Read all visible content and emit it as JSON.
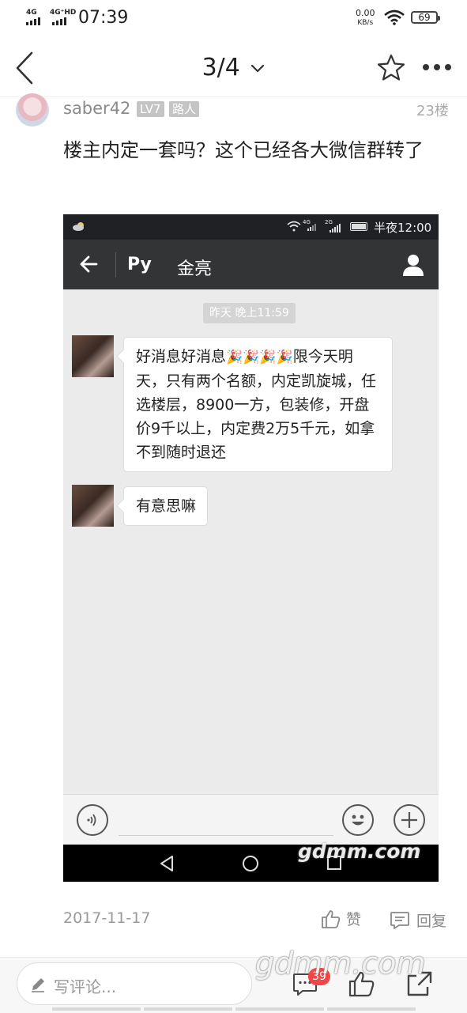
{
  "status_bar": {
    "sim1": "4G",
    "sim2": "4G⁺HD",
    "time": "07:39",
    "speed_value": "0.00",
    "speed_unit": "KB/s",
    "battery": "69"
  },
  "nav": {
    "page_indicator": "3/4"
  },
  "post": {
    "username": "saber42",
    "level": "LV7",
    "rank": "路人",
    "floor": "23楼",
    "text": "楼主内定一套吗？这个已经各大微信群转了",
    "date": "2017-11-17",
    "like_label": "赞",
    "reply_label": "回复"
  },
  "screenshot": {
    "status": {
      "network1": "4G",
      "network2": "2G",
      "time": "半夜12:00"
    },
    "header": {
      "group": "Py",
      "name": "金亮"
    },
    "timestamp": "昨天 晚上11:59",
    "messages": [
      {
        "text_before": "好消息好消息",
        "emoji": "🎉🎉🎉🎉",
        "text_after": "限今天明天，只有两个名额，内定凯旋城，任选楼层，8900一方，包装修，开盘价9千以上，内定费2万5千元，如拿不到随时退还"
      },
      {
        "text": "有意思嘛"
      }
    ],
    "watermark": "gdmm.com"
  },
  "bottom_bar": {
    "comment_placeholder": "写评论...",
    "comment_count": "39",
    "watermark": "gdmm.com"
  },
  "colors": {
    "badge_red": "#f24545",
    "wechat_header": "#333436",
    "chat_background": "#ebebeb"
  }
}
